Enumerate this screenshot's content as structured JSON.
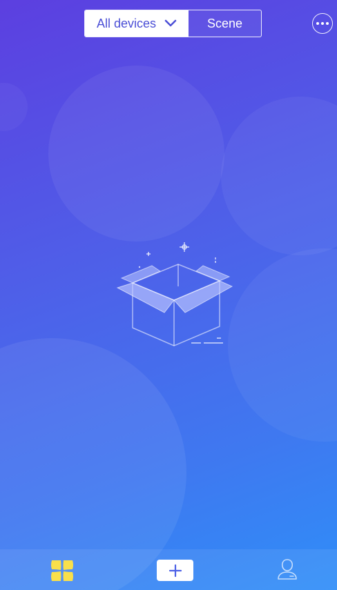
{
  "header": {
    "segments": [
      {
        "label": "All devices",
        "active": true
      },
      {
        "label": "Scene",
        "active": false
      }
    ],
    "more_icon": "ellipsis-circle-icon"
  },
  "empty_state": {
    "illustration": "open-box-icon"
  },
  "tabbar": {
    "items": [
      {
        "icon": "devices-grid-icon",
        "active": true,
        "color": "#f9e04b"
      },
      {
        "icon": "plus-icon",
        "active": false
      },
      {
        "icon": "user-profile-icon",
        "active": false
      }
    ]
  },
  "colors": {
    "background_start": "#5c3fe0",
    "background_end": "#2f8ef8",
    "segment_text_active": "#4b4fd6",
    "tab_active": "#f9e04b"
  }
}
